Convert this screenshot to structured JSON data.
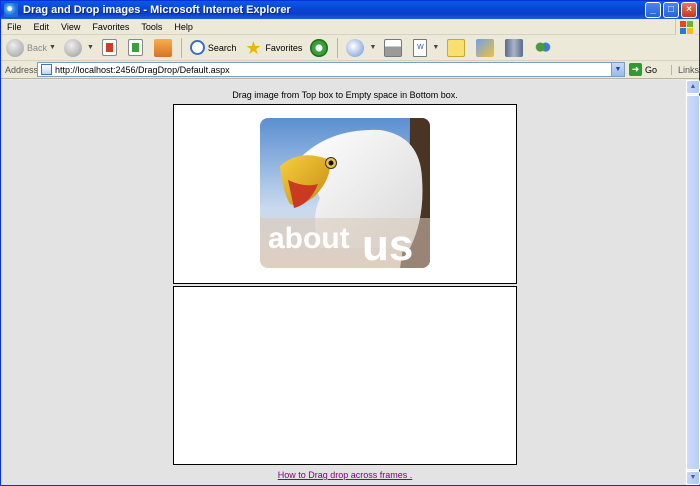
{
  "window": {
    "title": "Drag and Drop images - Microsoft Internet Explorer",
    "controls": {
      "minimize": "_",
      "maximize": "□",
      "close": "×"
    }
  },
  "menu": [
    "File",
    "Edit",
    "View",
    "Favorites",
    "Tools",
    "Help"
  ],
  "toolbar": {
    "back": "Back",
    "search": "Search",
    "favorites": "Favorites"
  },
  "address": {
    "label": "Address",
    "url": "http://localhost:2456/DragDrop/Default.aspx",
    "go": "Go",
    "links": "Links"
  },
  "page": {
    "instruction": "Drag image from Top box to Empty space in Bottom box.",
    "image_text_1": "about",
    "image_text_2": "us",
    "link": "How to Drag drop across frames ."
  },
  "colors": {
    "title_blue": "#0a47d6",
    "link_visited": "#800080",
    "content_bg": "#e3e3e3"
  }
}
